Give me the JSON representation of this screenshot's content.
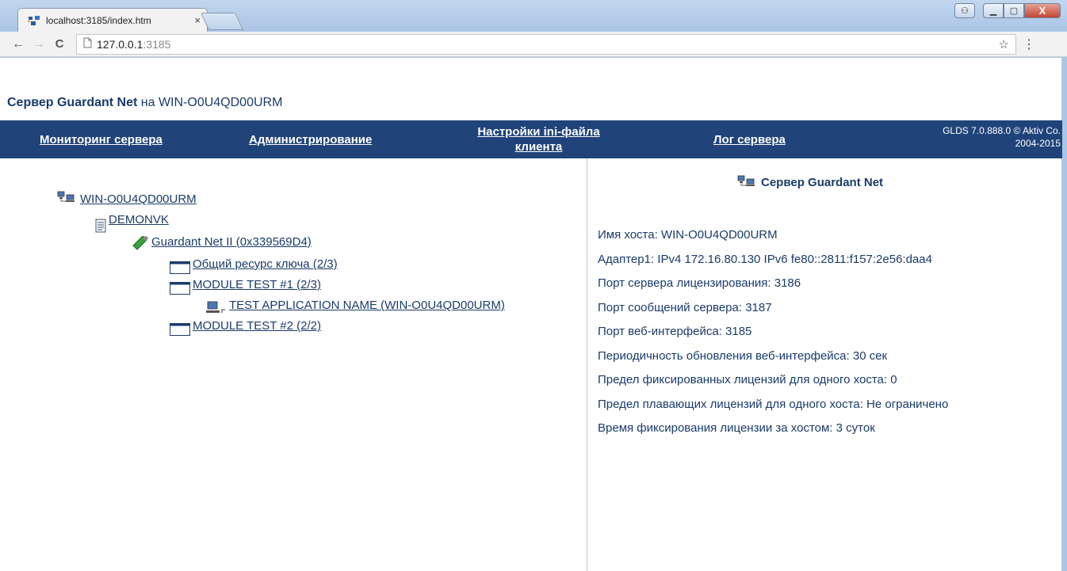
{
  "browser": {
    "tab_title": "localhost:3185/index.htm",
    "tab_close": "×",
    "url_host": "127.0.0.1",
    "url_port": ":3185",
    "back": "←",
    "forward": "→",
    "reload": "C",
    "star": "☆",
    "menu": "⋮",
    "window_buttons": {
      "user": "⚇",
      "minimize": "▁",
      "maximize": "▢",
      "close": "X"
    }
  },
  "header": {
    "title_bold": "Сервер Guardant Net",
    "title_suffix": "на WIN-O0U4QD00URM"
  },
  "nav": {
    "items": [
      {
        "label": "Мониторинг сервера"
      },
      {
        "label": "Администрирование"
      },
      {
        "label": "Настройки ini-файла клиента"
      },
      {
        "label": "Лог сервера"
      }
    ],
    "version_line1": "GLDS 7.0.888.0 © Aktiv Co.",
    "version_line2": "2004-2015"
  },
  "tree": {
    "host": "WIN-O0U4QD00URM",
    "group": "DEMONVK",
    "key": "Guardant Net II (0x339569D4)",
    "module_shared": "Общий ресурс ключа (2/3)",
    "module1": "MODULE TEST #1 (2/3)",
    "application": "TEST APPLICATION NAME (WIN-O0U4QD00URM)",
    "module2": "MODULE TEST #2 (2/2)"
  },
  "info": {
    "title": "Сервер Guardant Net",
    "lines": [
      "Имя хоста: WIN-O0U4QD00URM",
      "Адаптер1: IPv4 172.16.80.130 IPv6 fe80::2811:f157:2e56:daa4",
      "Порт сервера лицензирования: 3186",
      "Порт сообщений сервера: 3187",
      "Порт веб-интерфейса: 3185",
      "Периодичность обновления веб-интерфейса: 30 сек",
      "Предел фиксированных лицензий для одного хоста: 0",
      "Предел плавающих лицензий для одного хоста: Не ограничено",
      "Время фиксирования лицензии за хостом: 3 суток"
    ]
  },
  "colors": {
    "nav_background": "#20447a",
    "text": "#1a3b6b",
    "titlebar": "#a9c4e5"
  },
  "icons": {
    "tab": "network-grid-icon",
    "host": "network-computers-icon",
    "group": "document-list-icon",
    "key": "usb-dongle-icon",
    "module": "window-icon",
    "application": "computer-icon"
  }
}
